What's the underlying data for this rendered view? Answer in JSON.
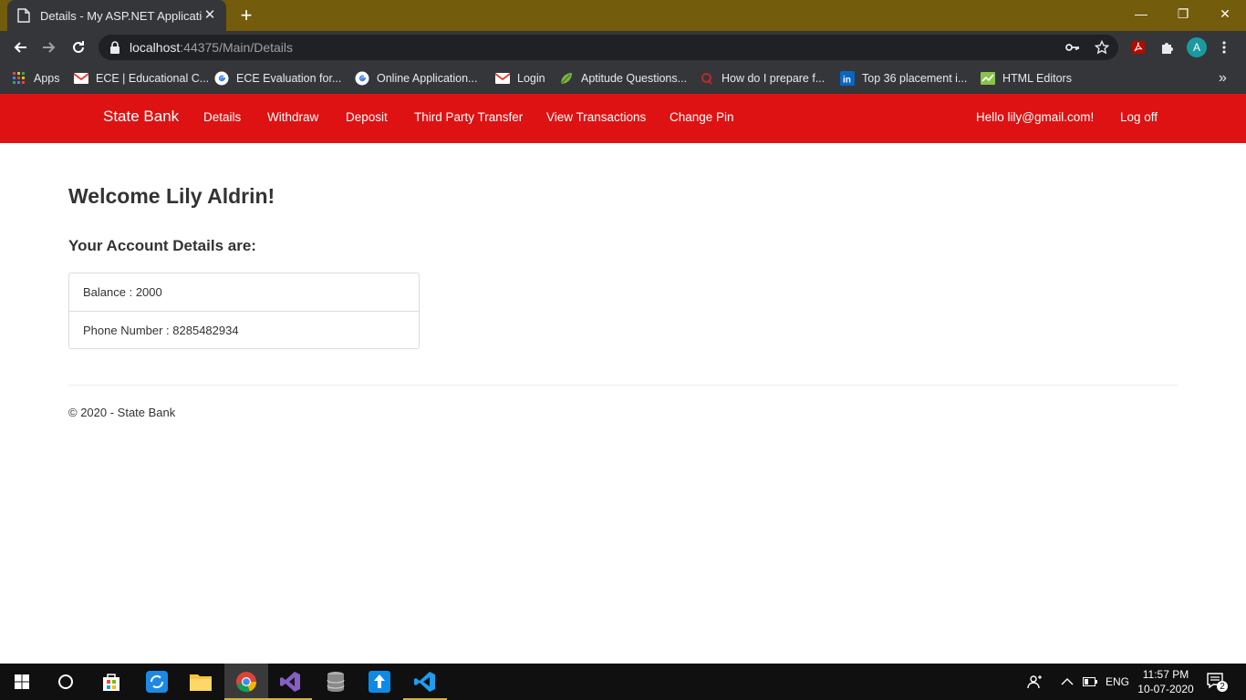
{
  "browser": {
    "tab_title": "Details - My ASP.NET Application",
    "tab_close": "✕",
    "new_tab": "+",
    "url_host": "localhost",
    "url_path": ":44375/Main/Details",
    "avatar_letter": "A",
    "bookmarks_more": "»",
    "window_controls": {
      "minimize": "—",
      "maximize": "❐",
      "close": "✕"
    }
  },
  "bookmarks": [
    {
      "label": "Apps",
      "icon": "apps-grid-icon"
    },
    {
      "label": "ECE | Educational C...",
      "icon": "gmail-icon"
    },
    {
      "label": "ECE Evaluation for...",
      "icon": "google-icon"
    },
    {
      "label": "Online Application...",
      "icon": "google-icon"
    },
    {
      "label": "Login",
      "icon": "gmail-icon"
    },
    {
      "label": "Aptitude Questions...",
      "icon": "leaf-icon"
    },
    {
      "label": "How do I prepare f...",
      "icon": "quora-icon"
    },
    {
      "label": "Top 36 placement i...",
      "icon": "linkedin-icon"
    },
    {
      "label": "HTML Editors",
      "icon": "chart-icon"
    }
  ],
  "navbar": {
    "brand": "State Bank",
    "links": [
      "Details",
      "Withdraw",
      "Deposit",
      "Third Party Transfer",
      "View Transactions",
      "Change Pin"
    ],
    "greeting": "Hello lily@gmail.com!",
    "logoff": "Log off",
    "background": "#de1212"
  },
  "main": {
    "welcome": "Welcome Lily Aldrin!",
    "subheading": "Your Account Details are:",
    "details": [
      "Balance : 2000",
      "Phone Number : 8285482934"
    ],
    "footer": "© 2020 - State Bank"
  },
  "taskbar": {
    "language": "ENG",
    "time": "11:57 PM",
    "date": "10-07-2020",
    "notification_count": "2"
  }
}
